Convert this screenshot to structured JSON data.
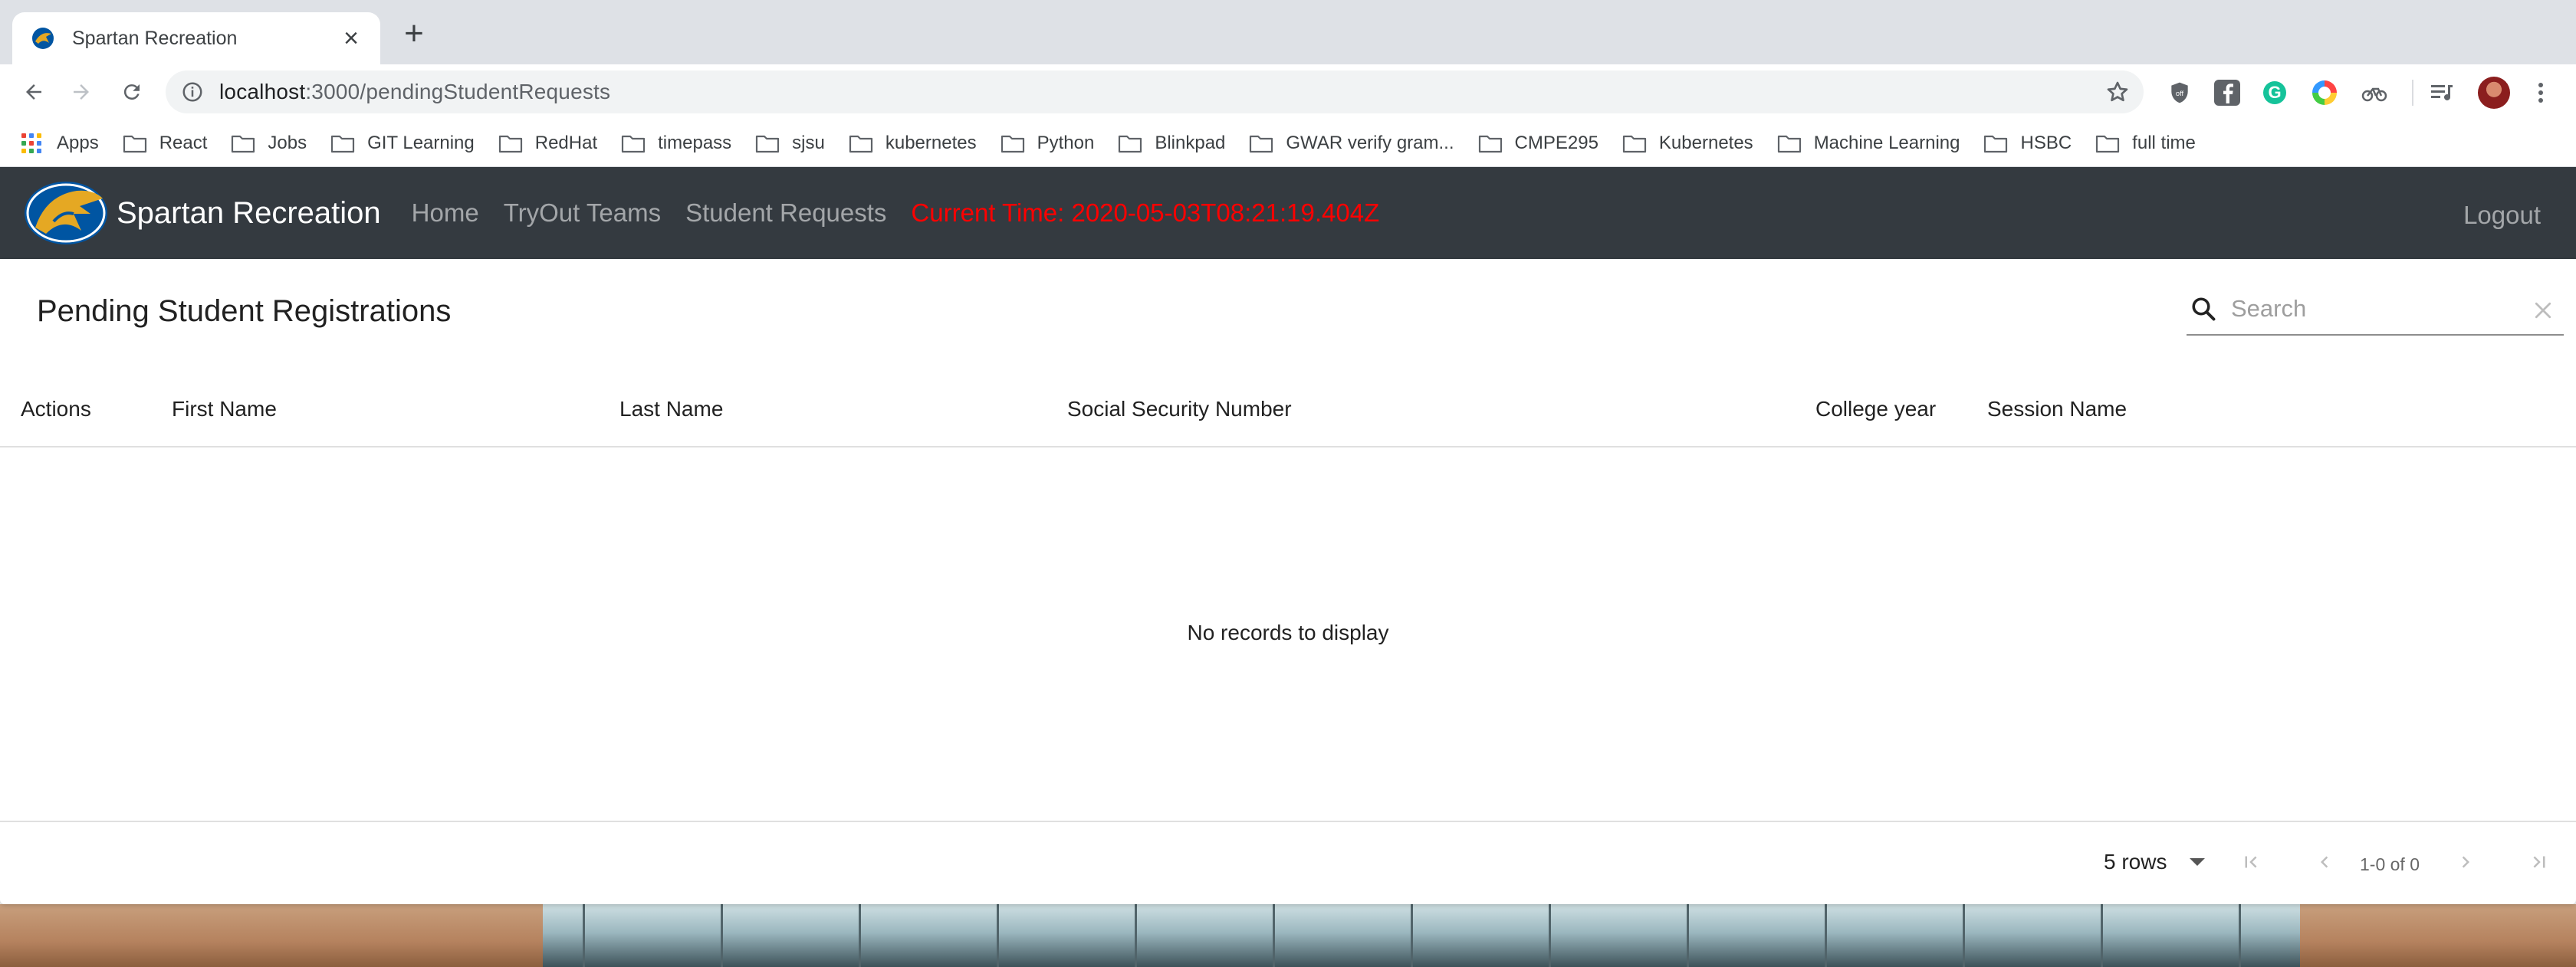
{
  "browser": {
    "tab_title": "Spartan Recreation",
    "url_host": "localhost",
    "url_path": ":3000/pendingStudentRequests",
    "bookmarks": [
      {
        "label": "Apps",
        "icon": "apps-grid-icon"
      },
      {
        "label": "React",
        "icon": "folder-icon"
      },
      {
        "label": "Jobs",
        "icon": "folder-icon"
      },
      {
        "label": "GIT Learning",
        "icon": "folder-icon"
      },
      {
        "label": "RedHat",
        "icon": "folder-icon"
      },
      {
        "label": "timepass",
        "icon": "folder-icon"
      },
      {
        "label": "sjsu",
        "icon": "folder-icon"
      },
      {
        "label": "kubernetes",
        "icon": "folder-icon"
      },
      {
        "label": "Python",
        "icon": "folder-icon"
      },
      {
        "label": "Blinkpad",
        "icon": "folder-icon"
      },
      {
        "label": "GWAR verify gram...",
        "icon": "folder-icon"
      },
      {
        "label": "CMPE295",
        "icon": "folder-icon"
      },
      {
        "label": "Kubernetes",
        "icon": "folder-icon"
      },
      {
        "label": "Machine Learning",
        "icon": "folder-icon"
      },
      {
        "label": "HSBC",
        "icon": "folder-icon"
      },
      {
        "label": "full time",
        "icon": "folder-icon"
      }
    ]
  },
  "navbar": {
    "brand": "Spartan Recreation",
    "links": [
      "Home",
      "TryOut Teams",
      "Student Requests"
    ],
    "current_time": "Current Time: 2020-05-03T08:21:19.404Z",
    "logout": "Logout",
    "bg_color": "#343a40",
    "time_color": "#ff0000"
  },
  "table": {
    "title": "Pending Student Registrations",
    "search_placeholder": "Search",
    "columns": [
      "Actions",
      "First Name",
      "Last Name",
      "Social Security Number",
      "College year",
      "Session Name"
    ],
    "rows": [],
    "empty_message": "No records to display",
    "rows_per_page": "5 rows",
    "pagination_info": "1-0 of 0"
  }
}
